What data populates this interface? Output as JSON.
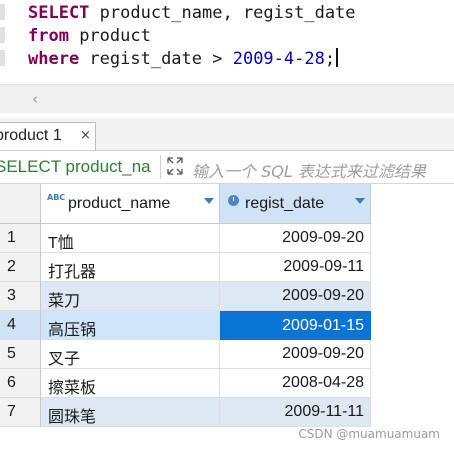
{
  "editor": {
    "line1": {
      "kw": "SELECT",
      "rest": " product_name, regist_date"
    },
    "line2": {
      "kw": "from",
      "rest": " product"
    },
    "line3": {
      "kw": "where",
      "rest": " regist_date > ",
      "num": "2009-4-28",
      "end": ";"
    }
  },
  "tab": {
    "label": "product 1",
    "close": "×"
  },
  "filter": {
    "query": "SELECT product_na",
    "placeholder": "输入一个 SQL 表达式来过滤结果"
  },
  "grid": {
    "columns": [
      {
        "type_icon": "abc",
        "label": "product_name"
      },
      {
        "type_icon": "clock",
        "label": "regist_date"
      }
    ],
    "rows": [
      {
        "num": "1",
        "product_name": "T恤",
        "regist_date": "2009-09-20"
      },
      {
        "num": "2",
        "product_name": "打孔器",
        "regist_date": "2009-09-11"
      },
      {
        "num": "3",
        "product_name": "菜刀",
        "regist_date": "2009-09-20"
      },
      {
        "num": "4",
        "product_name": "高压锅",
        "regist_date": "2009-01-15"
      },
      {
        "num": "5",
        "product_name": "叉子",
        "regist_date": "2009-09-20"
      },
      {
        "num": "6",
        "product_name": "擦菜板",
        "regist_date": "2008-04-28"
      },
      {
        "num": "7",
        "product_name": "圆珠笔",
        "regist_date": "2009-11-11"
      }
    ],
    "selected_row": "4"
  },
  "watermark": "CSDN @muamuamuam"
}
